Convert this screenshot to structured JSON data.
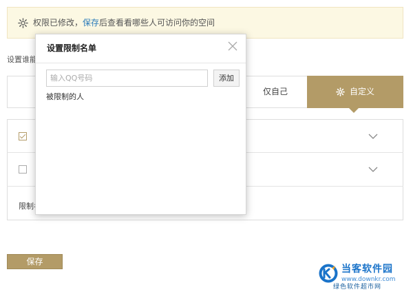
{
  "notice": {
    "prefix": "权限已修改，",
    "link": "保存",
    "suffix": "后查看看哪些人可访问你的空间",
    "icon": "gear-icon"
  },
  "setting_label": "设置谁能访",
  "options": {
    "self_label": "仅自己",
    "custom_label": "自定义",
    "custom_icon": "gear-icon",
    "active_color": "#b39b67"
  },
  "list": {
    "row1_checked": true,
    "row2_checked": false,
    "limit_label": "限制名"
  },
  "save_label": "保存",
  "modal": {
    "title": "设置限制名单",
    "input_placeholder": "输入QQ号码",
    "input_value": "",
    "add_label": "添加",
    "restricted_label": "被限制的人"
  },
  "watermark": {
    "line1": "当客软件园",
    "line2": "www.downkr.com",
    "line3": "绿色软件超市网"
  }
}
